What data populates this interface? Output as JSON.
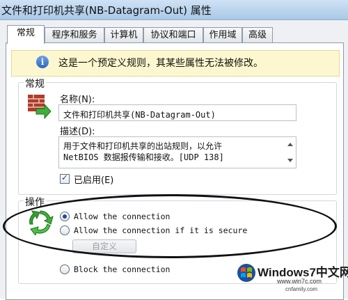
{
  "window": {
    "title": "文件和打印机共享(NB-Datagram-Out) 属性"
  },
  "tabs": [
    {
      "label": "常规",
      "active": true
    },
    {
      "label": "程序和服务",
      "active": false
    },
    {
      "label": "计算机",
      "active": false
    },
    {
      "label": "协议和端口",
      "active": false
    },
    {
      "label": "作用域",
      "active": false
    },
    {
      "label": "高级",
      "active": false
    }
  ],
  "info": {
    "icon": "info-icon",
    "text": "这是一个预定义规则，其某些属性无法被修改。"
  },
  "general": {
    "group_title": "常规",
    "icon": "firewall-rule-icon",
    "name_label": "名称(N):",
    "name_value": "文件和打印机共享(NB-Datagram-Out)",
    "desc_label": "描述(D):",
    "desc_line1": "用于文件和打印机共享的出站规则，以允许",
    "desc_line2": "NetBIOS 数据报传输和接收。[UDP 138]",
    "enabled_label": "已启用(E)",
    "enabled_checked": true
  },
  "action": {
    "group_title": "操作",
    "icon": "recycle-arrows-icon",
    "allow_label": "Allow the connection",
    "allow_secure_label": "Allow the connection if it is secure",
    "customize_label": "自定义",
    "block_label": "Block the connection",
    "selected": "allow"
  },
  "watermark": {
    "brand": "Windows7中文网",
    "url": "www.win7c.com",
    "site": "cnfamily.com"
  },
  "colors": {
    "titlebar": "#a9c8e6",
    "info_bg": "#fdf7cf",
    "accent": "#234a97"
  }
}
